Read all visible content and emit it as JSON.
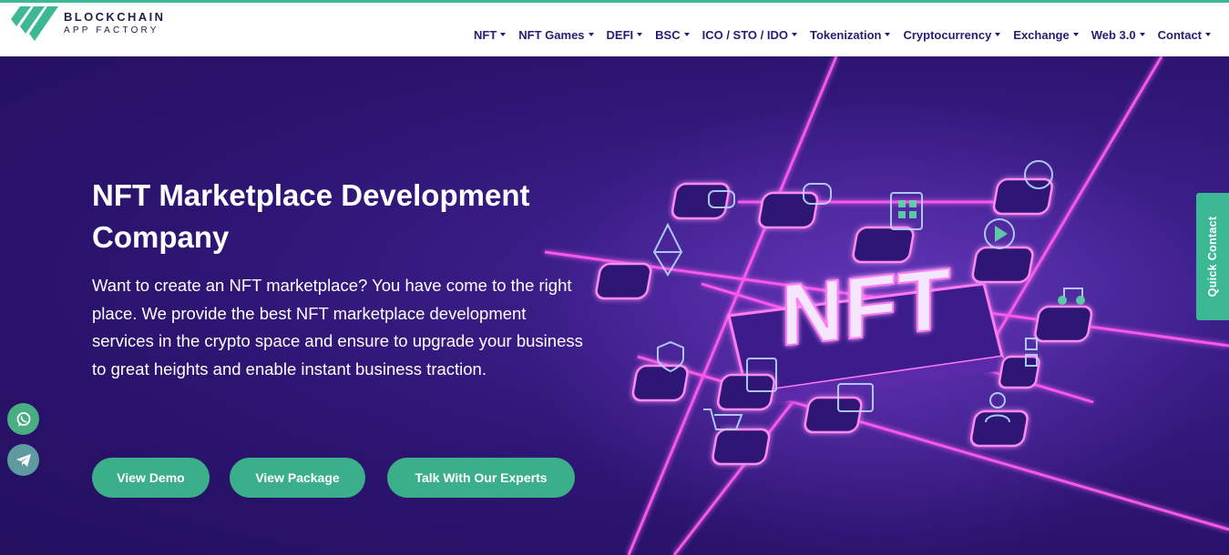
{
  "brand": {
    "name_line1": "BLOCKCHAIN",
    "name_line2": "APP FACTORY",
    "accent": "#3db894",
    "nav_color": "#2a1b73"
  },
  "nav": {
    "items": [
      {
        "label": "NFT"
      },
      {
        "label": "NFT Games"
      },
      {
        "label": "DEFI"
      },
      {
        "label": "BSC"
      },
      {
        "label": "ICO / STO / IDO"
      },
      {
        "label": "Tokenization"
      },
      {
        "label": "Cryptocurrency"
      },
      {
        "label": "Exchange"
      },
      {
        "label": "Web 3.0"
      },
      {
        "label": "Contact"
      }
    ]
  },
  "hero": {
    "title": "NFT Marketplace Development Company",
    "description": "Want to create an NFT marketplace? You have come to the right place. We provide the best NFT marketplace development services in the crypto space and ensure to upgrade your business to great heights and enable instant business traction.",
    "art_text": "NFT",
    "buttons": {
      "demo": "View Demo",
      "package": "View Package",
      "experts": "Talk With Our Experts"
    },
    "button_color": "#3aaf8a"
  },
  "social": {
    "whatsapp_icon": "whatsapp-icon",
    "telegram_icon": "telegram-icon"
  },
  "quick_contact": {
    "label": "Quick Contact"
  }
}
